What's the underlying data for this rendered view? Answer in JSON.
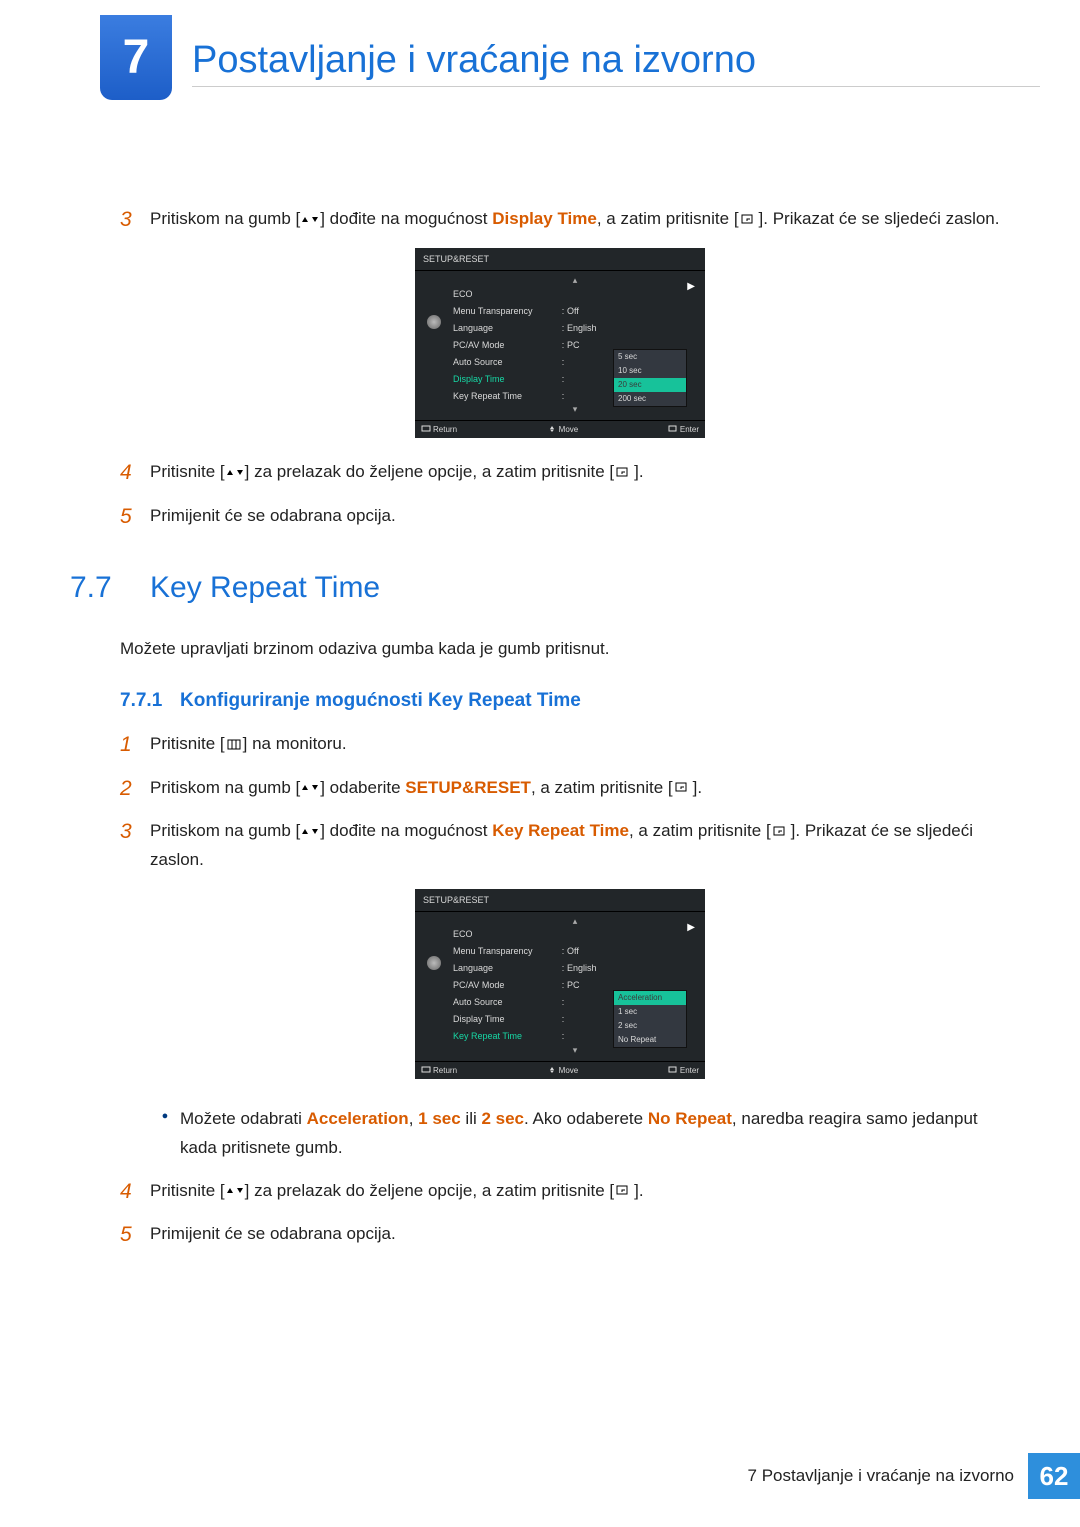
{
  "chapter": {
    "number": "7",
    "title": "Postavljanje i vraćanje na izvorno"
  },
  "steps_a": {
    "s3_a": "Pritiskom na gumb [",
    "s3_b": "] dođite na mogućnost ",
    "s3_hl": "Display Time",
    "s3_c": ", a zatim pritisnite [",
    "s3_d": "]. Prikazat će se sljedeći zaslon.",
    "s4_a": "Pritisnite [",
    "s4_b": "] za prelazak do željene opcije, a zatim pritisnite [",
    "s4_c": "].",
    "s5": "Primijenit će se odabrana opcija."
  },
  "osd1": {
    "title": "SETUP&RESET",
    "rows": {
      "eco": "ECO",
      "mt": "Menu Transparency",
      "mt_v": "Off",
      "lang": "Language",
      "lang_v": "English",
      "pc": "PC/AV Mode",
      "pc_v": "PC",
      "auto": "Auto Source",
      "disp": "Display Time",
      "krt": "Key Repeat Time"
    },
    "dropdown": [
      "5 sec",
      "10 sec",
      "20 sec",
      "200 sec"
    ],
    "dropdown_selected_index": 2,
    "footer": {
      "return": "Return",
      "move": "Move",
      "enter": "Enter"
    }
  },
  "section77": {
    "num": "7.7",
    "title": "Key Repeat Time",
    "intro": "Možete upravljati brzinom odaziva gumba kada je gumb pritisnut."
  },
  "sub771": {
    "num": "7.7.1",
    "title": "Konfiguriranje mogućnosti Key Repeat Time"
  },
  "steps_b": {
    "s1_a": "Pritisnite [",
    "s1_b": "] na monitoru.",
    "s2_a": "Pritiskom na gumb [",
    "s2_b": "] odaberite ",
    "s2_hl": "SETUP&RESET",
    "s2_c": ", a zatim pritisnite [",
    "s2_d": "].",
    "s3_a": "Pritiskom na gumb [",
    "s3_b": "] dođite na mogućnost ",
    "s3_hl": "Key Repeat Time",
    "s3_c": ", a zatim pritisnite [",
    "s3_d": "]. Prikazat će se sljedeći zaslon.",
    "bullet_a": "Možete odabrati ",
    "bullet_h1": "Acceleration",
    "bullet_m1": ", ",
    "bullet_h2": "1 sec",
    "bullet_m2": " ili ",
    "bullet_h3": "2 sec",
    "bullet_m3": ". Ako odaberete ",
    "bullet_h4": "No Repeat",
    "bullet_m4": ", naredba reagira samo jedanput kada pritisnete gumb.",
    "s4_a": "Pritisnite [",
    "s4_b": "] za prelazak do željene opcije, a zatim pritisnite [",
    "s4_c": "].",
    "s5": "Primijenit će se odabrana opcija."
  },
  "osd2": {
    "title": "SETUP&RESET",
    "rows": {
      "eco": "ECO",
      "mt": "Menu Transparency",
      "mt_v": "Off",
      "lang": "Language",
      "lang_v": "English",
      "pc": "PC/AV Mode",
      "pc_v": "PC",
      "auto": "Auto Source",
      "disp": "Display Time",
      "krt": "Key Repeat Time"
    },
    "dropdown": [
      "Acceleration",
      "1 sec",
      "2 sec",
      "No Repeat"
    ],
    "dropdown_selected_index": 0,
    "footer": {
      "return": "Return",
      "move": "Move",
      "enter": "Enter"
    }
  },
  "footer": {
    "label": "7 Postavljanje i vraćanje na izvorno",
    "page": "62"
  }
}
